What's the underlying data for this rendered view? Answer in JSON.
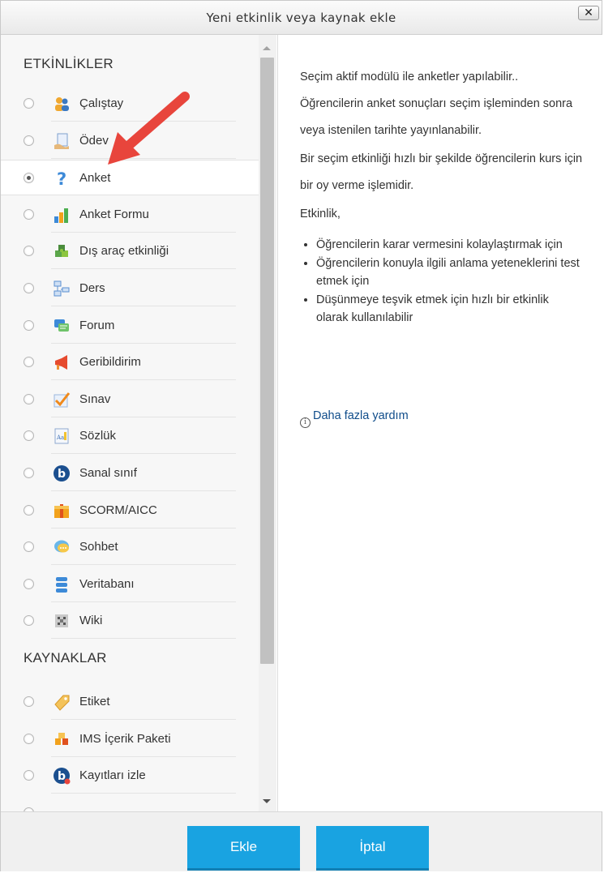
{
  "dialog": {
    "title": "Yeni etkinlik veya kaynak ekle",
    "close_label": "✕"
  },
  "sections": {
    "activities_title": "ETKİNLİKLER",
    "resources_title": "KAYNAKLAR"
  },
  "activities": [
    {
      "label": "Çalıştay",
      "icon": "workshop-icon",
      "selected": false
    },
    {
      "label": "Ödev",
      "icon": "assignment-icon",
      "selected": false
    },
    {
      "label": "Anket",
      "icon": "question-icon",
      "selected": true
    },
    {
      "label": "Anket Formu",
      "icon": "bar-chart-icon",
      "selected": false
    },
    {
      "label": "Dış araç etkinliği",
      "icon": "puzzle-icon",
      "selected": false
    },
    {
      "label": "Ders",
      "icon": "lesson-icon",
      "selected": false
    },
    {
      "label": "Forum",
      "icon": "forum-icon",
      "selected": false
    },
    {
      "label": "Geribildirim",
      "icon": "megaphone-icon",
      "selected": false
    },
    {
      "label": "Sınav",
      "icon": "quiz-check-icon",
      "selected": false
    },
    {
      "label": "Sözlük",
      "icon": "glossary-icon",
      "selected": false
    },
    {
      "label": "Sanal sınıf",
      "icon": "bigbluebutton-icon",
      "selected": false
    },
    {
      "label": "SCORM/AICC",
      "icon": "scorm-package-icon",
      "selected": false
    },
    {
      "label": "Sohbet",
      "icon": "chat-bubble-icon",
      "selected": false
    },
    {
      "label": "Veritabanı",
      "icon": "database-icon",
      "selected": false
    },
    {
      "label": "Wiki",
      "icon": "wiki-icon",
      "selected": false
    }
  ],
  "resources": [
    {
      "label": "Etiket",
      "icon": "label-tag-icon",
      "selected": false
    },
    {
      "label": "IMS İçerik Paketi",
      "icon": "ims-package-icon",
      "selected": false
    },
    {
      "label": "Kayıtları izle",
      "icon": "recordings-icon",
      "selected": false
    }
  ],
  "description": {
    "p1": "Seçim aktif modülü ile anketler yapılabilir.. Öğrencilerin anket sonuçları seçim işleminden sonra veya istenilen tarihte yayınlanabilir.",
    "p2": "Bir seçim etkinliği hızlı bir şekilde öğrencilerin kurs için bir oy verme işlemidir.",
    "p3": "Etkinlik,",
    "bullets": [
      "Öğrencilerin karar vermesini kolaylaştırmak için",
      "Öğrencilerin konuyla ilgili anlama yeteneklerini test etmek için",
      "Düşünmeye teşvik etmek için hızlı bir etkinlik olarak kullanılabilir"
    ],
    "more_help": "Daha fazla yardım"
  },
  "footer": {
    "add_label": "Ekle",
    "cancel_label": "İptal"
  },
  "colors": {
    "button_blue": "#19a3e1",
    "link_blue": "#0f4c8a",
    "arrow_red": "#e8453c"
  }
}
